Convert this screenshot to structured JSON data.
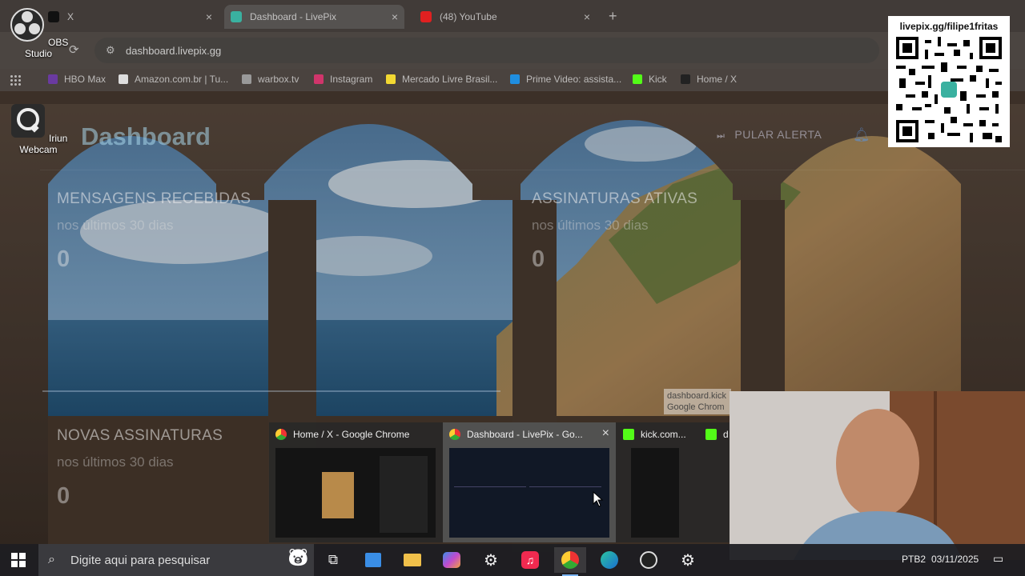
{
  "browser": {
    "tabs": [
      {
        "label": "X",
        "icon": "x-logo-icon",
        "close": "×"
      },
      {
        "label": "Dashboard - LivePix",
        "icon": "livepix-logo-icon",
        "close": "×"
      },
      {
        "label": "(48) YouTube",
        "icon": "youtube-logo-icon",
        "close": "×"
      }
    ],
    "new_tab": "+",
    "url": "dashboard.livepix.gg",
    "bookmarks": [
      {
        "label": "HBO Max",
        "icon": "hbo-icon"
      },
      {
        "label": "Amazon.com.br | Tu...",
        "icon": "amazon-icon"
      },
      {
        "label": "warbox.tv",
        "icon": "warbox-icon"
      },
      {
        "label": "Instagram",
        "icon": "instagram-icon"
      },
      {
        "label": "Mercado Livre Brasil...",
        "icon": "mercadolivre-icon"
      },
      {
        "label": "Prime Video: assista...",
        "icon": "primevideo-icon"
      },
      {
        "label": "Kick",
        "icon": "kick-icon"
      },
      {
        "label": "Home / X",
        "icon": "x-logo-icon"
      }
    ]
  },
  "desktop": {
    "icons": [
      {
        "label": "OBS Studio",
        "icon": "obs-icon"
      },
      {
        "label": "Iriun Webcam",
        "icon": "iriun-webcam-icon"
      }
    ]
  },
  "dashboard": {
    "title": "Dashboard",
    "skip_alert": "PULAR ALERTA",
    "cards": [
      {
        "title": "MENSAGENS RECEBIDAS",
        "subtitle": "nos últimos 30 dias",
        "value": "0"
      },
      {
        "title": "ASSINATURAS ATIVAS",
        "subtitle": "nos últimos 30 dias",
        "value": "0"
      },
      {
        "title": "NOVAS ASSINATURAS",
        "subtitle": "nos últimos 30 dias",
        "value": "0"
      }
    ]
  },
  "qr_overlay": {
    "label": "livepix.gg/filipe1fritas"
  },
  "tooltip": {
    "line1": "dashboard.kick",
    "line2": "Google Chrom"
  },
  "taskbar_previews": [
    {
      "title": "Home / X - Google Chrome",
      "icon": "chrome-icon"
    },
    {
      "title": "Dashboard - LivePix - Go...",
      "icon": "chrome-icon",
      "close": "×"
    },
    {
      "title": "kick.com...",
      "icon": "kick-icon"
    },
    {
      "title": "d",
      "icon": "kick-icon"
    }
  ],
  "taskbar": {
    "search_placeholder": "Digite aqui para pesquisar",
    "apps": [
      "task-view-icon",
      "store-icon",
      "file-explorer-icon",
      "copilot-icon",
      "chatgpt-icon",
      "itunes-icon",
      "chrome-icon",
      "edge-icon",
      "obs-icon",
      "settings-icon"
    ],
    "keyboard": "PTB2",
    "date": "03/11/2025"
  },
  "colors": {
    "accent": "#7ab4f2",
    "taskbar": "#1e1e22",
    "search": "#3a3a3e"
  }
}
